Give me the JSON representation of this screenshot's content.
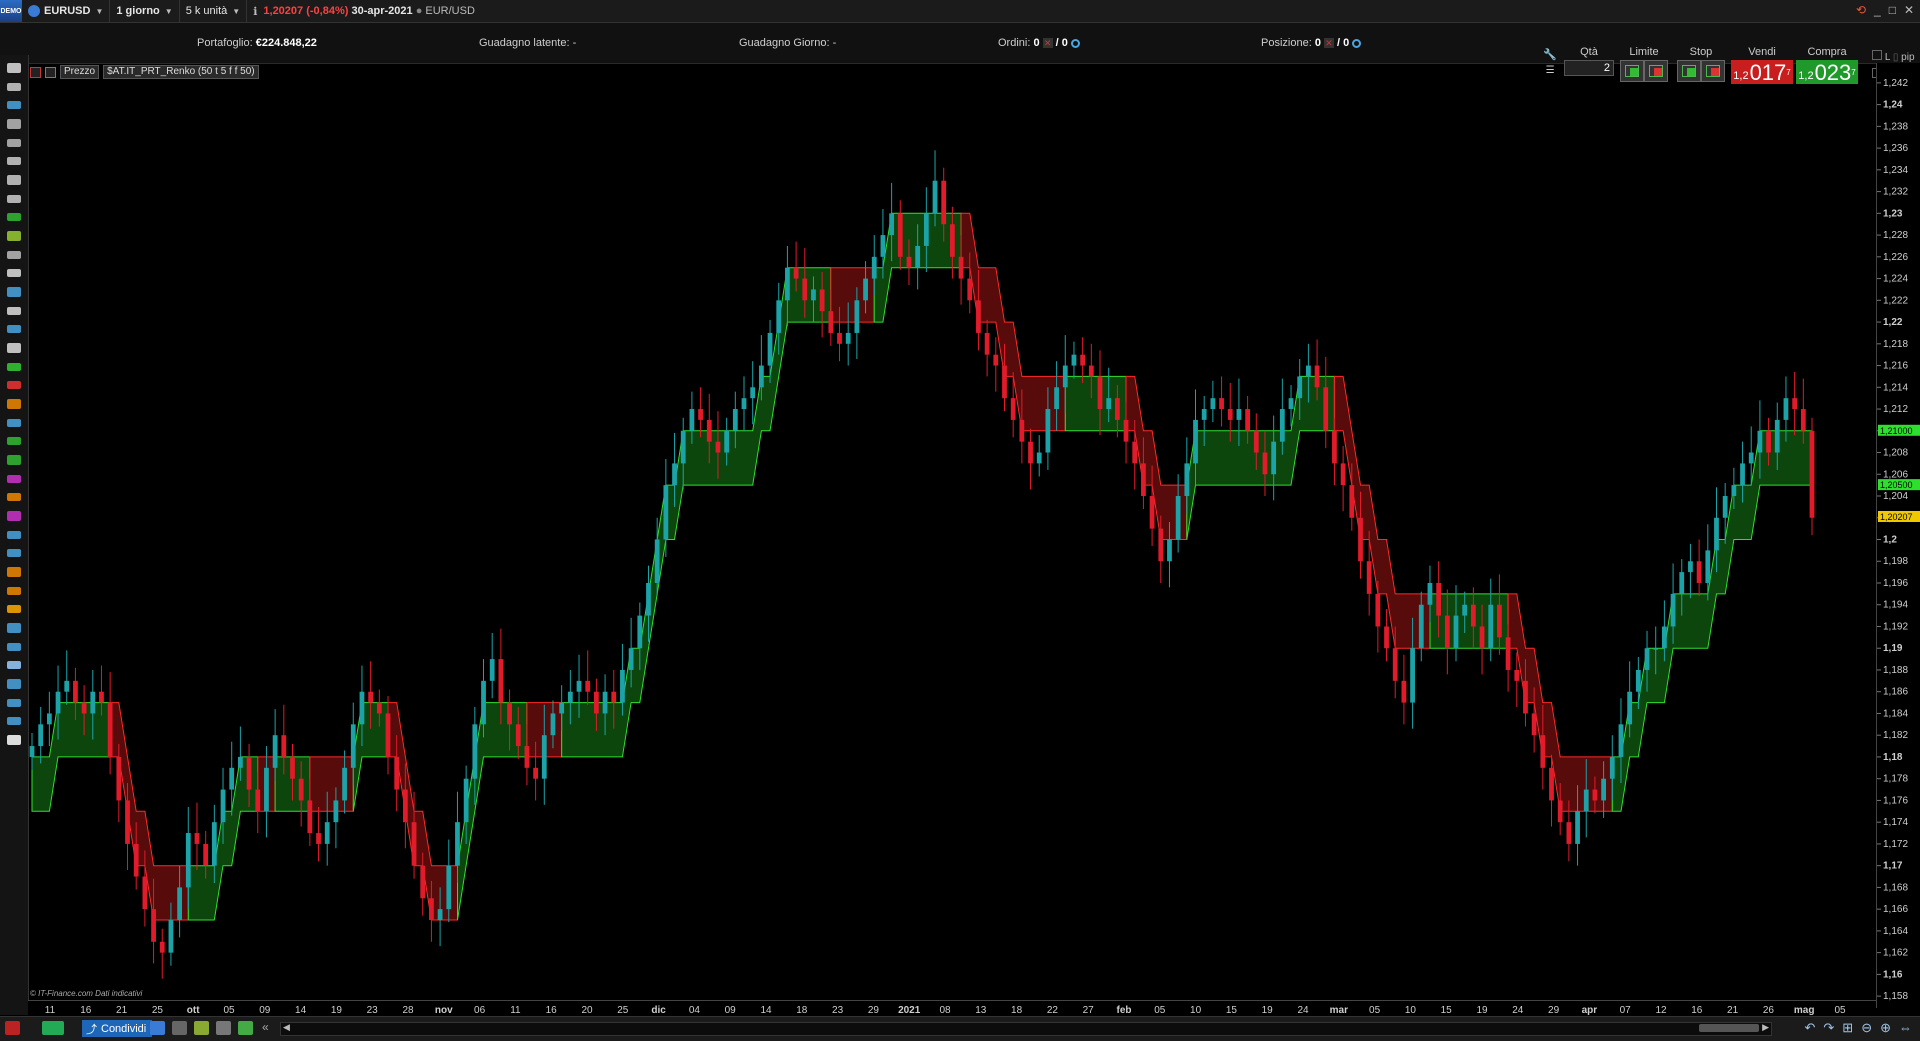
{
  "topbar": {
    "logo": "DEMO",
    "instrument": "EURUSD",
    "timeframe": "1 giorno",
    "units": "5 k unità",
    "last_price": "1,20207",
    "change": "(-0,84%)",
    "date": "30-apr-2021",
    "pair": "EUR/USD"
  },
  "infobar": {
    "portfolio_label": "Portafoglio:",
    "portfolio_value": "€224.848,22",
    "latent_label": "Guadagno latente:",
    "latent_value": "-",
    "day_label": "Guadagno Giorno:",
    "day_value": "-",
    "orders_label": "Ordini:",
    "orders_value_a": "0",
    "orders_value_b": "/ 0",
    "position_label": "Posizione:",
    "position_value_a": "0",
    "position_value_b": "/ 0"
  },
  "trade": {
    "qty_label": "Qtà",
    "qty_value": "2",
    "limit_label": "Limite",
    "stop_label": "Stop",
    "sell_label": "Vendi",
    "buy_label": "Compra",
    "sell_price_small": "1,2",
    "sell_price_big": "017",
    "sell_price_sup": "7",
    "buy_price_small": "1,2",
    "buy_price_big": "023",
    "buy_price_sup": "7",
    "l_label": "L",
    "s_label": "S",
    "pip_label": "pip"
  },
  "legend": {
    "price_label": "Prezzo",
    "indicator_label": "$AT.IT_PRT_Renko (50 t 5 f f 50)"
  },
  "footer_note": "© IT-Finance.com  Dati indicativi",
  "bottombar": {
    "share_label": "Condividi"
  },
  "colors": {
    "bull_candle": "#1ba3a8",
    "bear_candle": "#e11b2a",
    "renko_up_fill": "#0d4a0d",
    "renko_up_line": "#2ee02e",
    "renko_down_fill": "#5c0c0c",
    "renko_down_line": "#ff2a2a",
    "last_price_tag": "#f0c800"
  },
  "chart_data": {
    "type": "candlestick",
    "y_range": [
      1.157,
      1.243
    ],
    "y_ticks": [
      "1,242",
      "1,24",
      "1,238",
      "1,236",
      "1,234",
      "1,232",
      "1,23",
      "1,228",
      "1,226",
      "1,224",
      "1,222",
      "1,22",
      "1,218",
      "1,216",
      "1,214",
      "1,212",
      "1,21",
      "1,208",
      "1,206",
      "1,204",
      "1,202",
      "1,2",
      "1,198",
      "1,196",
      "1,194",
      "1,192",
      "1,19",
      "1,188",
      "1,186",
      "1,184",
      "1,182",
      "1,18",
      "1,178",
      "1,176",
      "1,174",
      "1,172",
      "1,17",
      "1,168",
      "1,166",
      "1,164",
      "1,162",
      "1,16",
      "1,158"
    ],
    "y_ticks_bold": [
      "1,24",
      "1,23",
      "1,22",
      "1,21",
      "1,2",
      "1,19",
      "1,18",
      "1,17",
      "1,16"
    ],
    "price_tags": [
      {
        "value": 1.21,
        "label": "1,21000",
        "color": "#2ee02e"
      },
      {
        "value": 1.205,
        "label": "1,20500",
        "color": "#2ee02e"
      },
      {
        "value": 1.20207,
        "label": "1,20207",
        "color": "#f0c800"
      }
    ],
    "x_labels": [
      "11",
      "16",
      "21",
      "25",
      "ott",
      "05",
      "09",
      "14",
      "19",
      "23",
      "28",
      "nov",
      "06",
      "11",
      "16",
      "20",
      "25",
      "dic",
      "04",
      "09",
      "14",
      "18",
      "23",
      "29",
      "2021",
      "08",
      "13",
      "18",
      "22",
      "27",
      "feb",
      "05",
      "10",
      "15",
      "19",
      "24",
      "mar",
      "05",
      "10",
      "15",
      "19",
      "24",
      "29",
      "apr",
      "07",
      "12",
      "16",
      "21",
      "26",
      "mag",
      "05"
    ],
    "x_labels_bold": [
      "ott",
      "nov",
      "dic",
      "2021",
      "feb",
      "mar",
      "apr",
      "mag"
    ],
    "closes": [
      1.181,
      1.183,
      1.184,
      1.186,
      1.187,
      1.185,
      1.184,
      1.186,
      1.185,
      1.18,
      1.176,
      1.172,
      1.169,
      1.166,
      1.163,
      1.162,
      1.165,
      1.168,
      1.173,
      1.172,
      1.17,
      1.174,
      1.177,
      1.179,
      1.18,
      1.177,
      1.175,
      1.179,
      1.182,
      1.18,
      1.178,
      1.176,
      1.173,
      1.172,
      1.174,
      1.176,
      1.179,
      1.183,
      1.186,
      1.185,
      1.184,
      1.18,
      1.177,
      1.174,
      1.17,
      1.167,
      1.165,
      1.166,
      1.17,
      1.174,
      1.178,
      1.183,
      1.187,
      1.189,
      1.185,
      1.183,
      1.181,
      1.179,
      1.178,
      1.182,
      1.184,
      1.185,
      1.186,
      1.187,
      1.186,
      1.184,
      1.186,
      1.185,
      1.188,
      1.19,
      1.193,
      1.196,
      1.2,
      1.205,
      1.207,
      1.21,
      1.212,
      1.211,
      1.209,
      1.208,
      1.21,
      1.212,
      1.213,
      1.214,
      1.216,
      1.219,
      1.222,
      1.225,
      1.224,
      1.222,
      1.223,
      1.221,
      1.219,
      1.218,
      1.219,
      1.222,
      1.224,
      1.226,
      1.228,
      1.23,
      1.226,
      1.225,
      1.227,
      1.23,
      1.233,
      1.229,
      1.226,
      1.224,
      1.222,
      1.219,
      1.217,
      1.216,
      1.213,
      1.211,
      1.209,
      1.207,
      1.208,
      1.212,
      1.214,
      1.216,
      1.217,
      1.216,
      1.215,
      1.212,
      1.213,
      1.211,
      1.209,
      1.207,
      1.204,
      1.201,
      1.198,
      1.2,
      1.204,
      1.207,
      1.211,
      1.212,
      1.213,
      1.212,
      1.211,
      1.212,
      1.21,
      1.208,
      1.206,
      1.209,
      1.212,
      1.213,
      1.215,
      1.216,
      1.214,
      1.21,
      1.207,
      1.205,
      1.202,
      1.198,
      1.195,
      1.192,
      1.19,
      1.187,
      1.185,
      1.19,
      1.194,
      1.196,
      1.193,
      1.19,
      1.193,
      1.194,
      1.192,
      1.19,
      1.194,
      1.191,
      1.188,
      1.187,
      1.184,
      1.182,
      1.179,
      1.176,
      1.174,
      1.172,
      1.175,
      1.177,
      1.176,
      1.178,
      1.18,
      1.183,
      1.186,
      1.188,
      1.19,
      1.19,
      1.192,
      1.195,
      1.197,
      1.198,
      1.196,
      1.199,
      1.202,
      1.204,
      1.205,
      1.207,
      1.208,
      1.21,
      1.208,
      1.211,
      1.213,
      1.212,
      1.21,
      1.202
    ]
  }
}
